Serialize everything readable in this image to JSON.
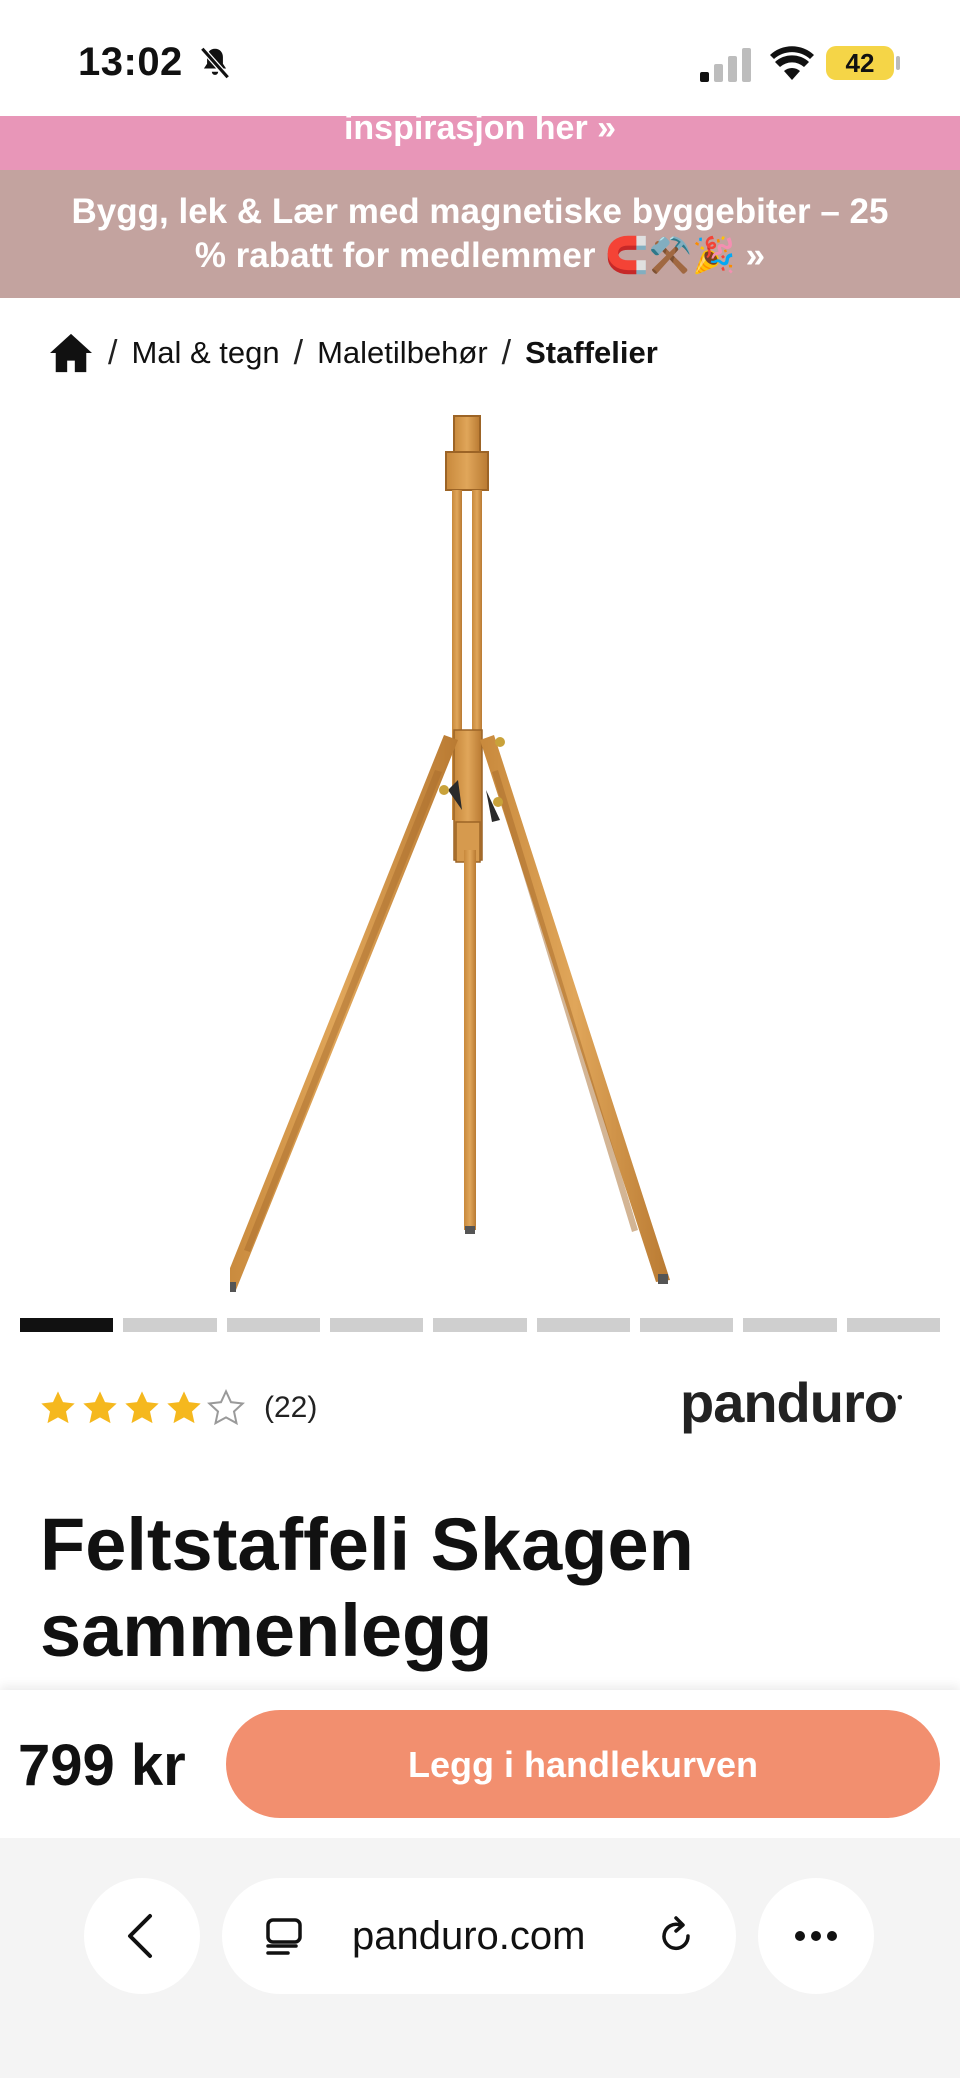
{
  "status_bar": {
    "time": "13:02",
    "battery": "42",
    "icons": [
      "bell-slash-icon",
      "cellular-signal-icon",
      "wifi-icon",
      "battery-icon"
    ]
  },
  "banners": {
    "top_partial": "inspirasjon her »",
    "promo_line1": "Bygg, lek & Lær med magnetiske byggebiter – 25",
    "promo_line2": "% rabatt for medlemmer 🧲⚒️🎉 »"
  },
  "breadcrumb": {
    "home_icon": "home-icon",
    "items": [
      "Mal & tegn",
      "Maletilbehør",
      "Staffelier"
    ],
    "separator": "/"
  },
  "carousel": {
    "total": 9,
    "active_index": 0
  },
  "product": {
    "rating": 4,
    "rating_max": 5,
    "review_count": "(22)",
    "brand": "panduro",
    "title_line1": "Feltstaffeli Skagen",
    "title_line2": "sammenlegg",
    "price": "799 kr",
    "add_to_cart": "Legg i handlekurven"
  },
  "browser": {
    "url": "panduro.com",
    "icons": [
      "back-icon",
      "tabs-icon",
      "reload-icon",
      "more-icon"
    ]
  },
  "colors": {
    "pink_banner": "#e896b8",
    "brown_banner": "#c3a39f",
    "cart_button": "#f28f6f",
    "star": "#f5b81e",
    "battery": "#f5d547"
  }
}
